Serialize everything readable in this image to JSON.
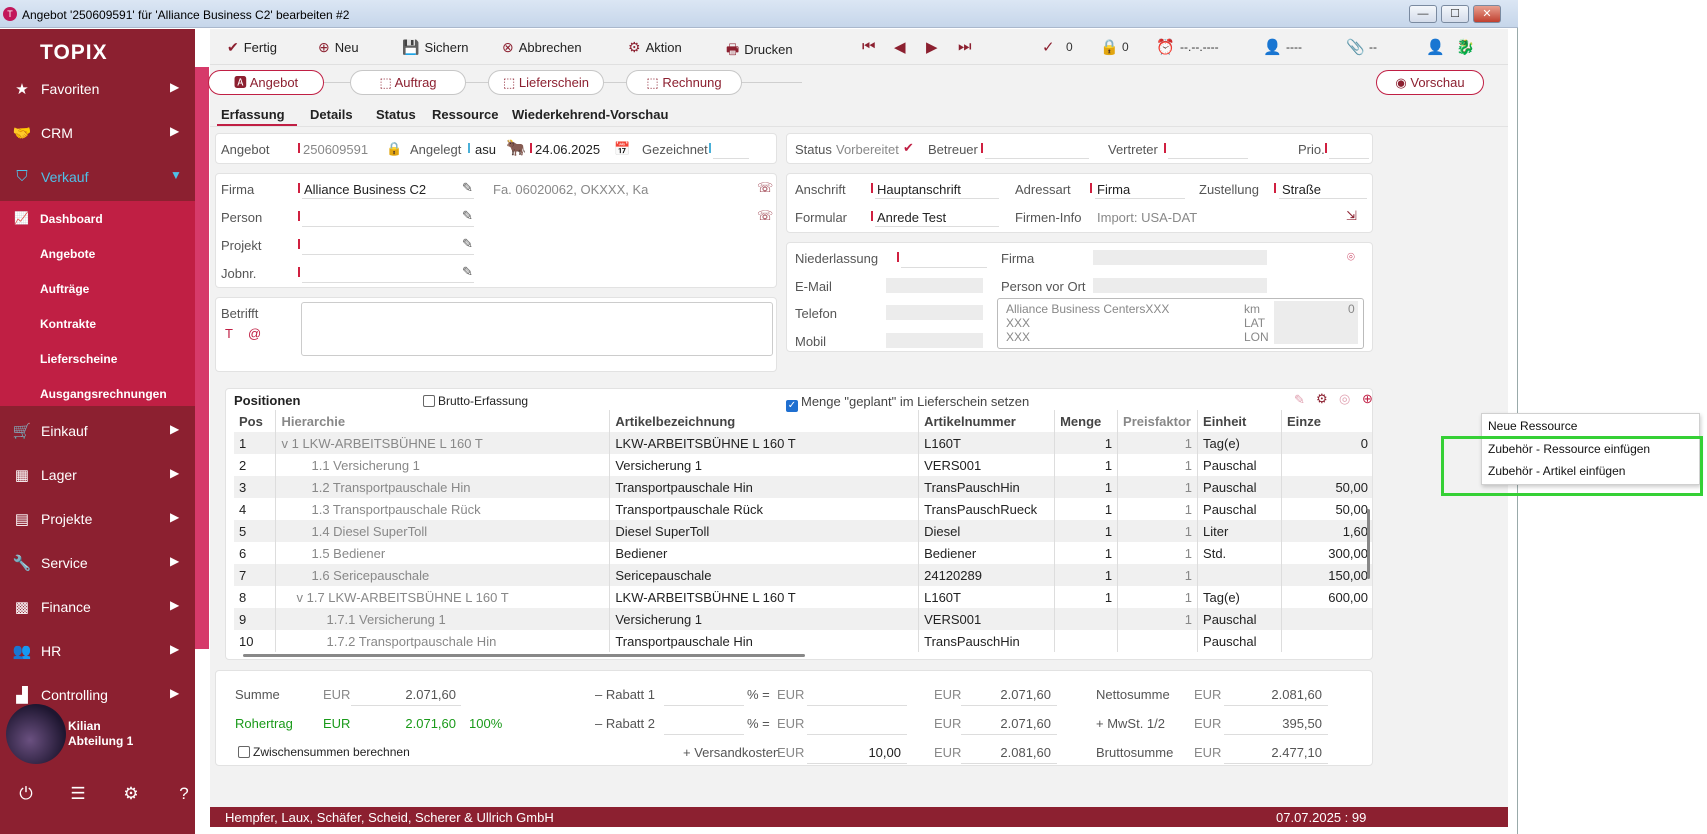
{
  "window": {
    "title": "Angebot '250609591' für 'Alliance Business C2' bearbeiten #2",
    "min": "—",
    "max": "☐",
    "close": "✕"
  },
  "sidebar": {
    "logo": "TOPIX",
    "items": [
      {
        "label": "Favoriten",
        "icon": "star-icon"
      },
      {
        "label": "CRM",
        "icon": "handshake-icon"
      },
      {
        "label": "Verkauf",
        "icon": "tag-icon"
      },
      {
        "label": "Einkauf",
        "icon": "cart-icon"
      },
      {
        "label": "Lager",
        "icon": "warehouse-icon"
      },
      {
        "label": "Projekte",
        "icon": "projects-icon"
      },
      {
        "label": "Service",
        "icon": "wrench-icon"
      },
      {
        "label": "Finance",
        "icon": "finance-icon"
      },
      {
        "label": "HR",
        "icon": "people-icon"
      },
      {
        "label": "Controlling",
        "icon": "chart-icon"
      }
    ],
    "sub": [
      "Dashboard",
      "Angebote",
      "Aufträge",
      "Kontrakte",
      "Lieferscheine",
      "Ausgangsrechnungen"
    ],
    "user": {
      "name": "Kilian",
      "dept": "Abteilung 1"
    }
  },
  "toolbar": {
    "fertig": "Fertig",
    "neu": "Neu",
    "sichern": "Sichern",
    "abbrechen": "Abbrechen",
    "aktion": "Aktion",
    "drucken": "Drucken",
    "check_count": "0",
    "lock_count": "0",
    "date_placeholder": "--.--.----",
    "person_placeholder": "----",
    "link_placeholder": "--"
  },
  "workflow": {
    "angebot": "Angebot",
    "auftrag": "Auftrag",
    "lieferschein": "Lieferschein",
    "rechnung": "Rechnung",
    "vorschau": "Vorschau"
  },
  "tabs": [
    "Erfassung",
    "Details",
    "Status",
    "Ressource",
    "Wiederkehrend-Vorschau"
  ],
  "header": {
    "angebot_label": "Angebot",
    "angebot_value": "250609591",
    "angelegt_label": "Angelegt",
    "angelegt_user": "asu",
    "angelegt_date": "24.06.2025",
    "gezeichnet_label": "Gezeichnet",
    "status_label": "Status",
    "status_value": "Vorbereitet",
    "betreuer_label": "Betreuer",
    "vertreter_label": "Vertreter",
    "prio_label": "Prio."
  },
  "customer": {
    "firma_label": "Firma",
    "firma_value": "Alliance Business C2",
    "firma_info": "Fa. 06020062, OKXXX, Ka",
    "person_label": "Person",
    "projekt_label": "Projekt",
    "jobnr_label": "Jobnr.",
    "anschrift_label": "Anschrift",
    "anschrift_value": "Hauptanschrift",
    "adressart_label": "Adressart",
    "adressart_value": "Firma",
    "zustellung_label": "Zustellung",
    "zustellung_value": "Straße",
    "formular_label": "Formular",
    "formular_value": "Anrede Test",
    "firmeninfo_label": "Firmen-Info",
    "firmeninfo_value": "Import: USA-DAT"
  },
  "contact": {
    "niederlassung_label": "Niederlassung",
    "firma_label": "Firma",
    "email_label": "E-Mail",
    "person_vor_ort_label": "Person vor Ort",
    "telefon_label": "Telefon",
    "mobil_label": "Mobil",
    "address": [
      "Alliance Business CentersXXX",
      "XXX",
      "XXX"
    ],
    "km_label": "km",
    "km_value": "0",
    "lat_label": "LAT",
    "lon_label": "LON"
  },
  "betrifft_label": "Betrifft",
  "positions": {
    "title": "Positionen",
    "brutto_label": "Brutto-Erfassung",
    "menge_label": "Menge \"geplant\" im Lieferschein setzen",
    "columns": [
      "Pos",
      "Hierarchie",
      "Artikelbezeichnung",
      "Artikelnummer",
      "Menge",
      "Preisfaktor",
      "Einheit",
      "Einze"
    ],
    "rows": [
      [
        "1",
        "v  1 LKW-ARBEITSBÜHNE L 160 T",
        "LKW-ARBEITSBÜHNE L 160 T",
        "L160T",
        "1",
        "1",
        "Tag(e)",
        "0"
      ],
      [
        "2",
        "1.1 Versicherung 1",
        "Versicherung 1",
        "VERS001",
        "1",
        "1",
        "Pauschal",
        ""
      ],
      [
        "3",
        "1.2 Transportpauschale Hin",
        "Transportpauschale Hin",
        "TransPauschHin",
        "1",
        "1",
        "Pauschal",
        "50,00"
      ],
      [
        "4",
        "1.3 Transportpauschale Rück",
        "Transportpauschale Rück",
        "TransPauschRueck",
        "1",
        "1",
        "Pauschal",
        "50,00"
      ],
      [
        "5",
        "1.4 Diesel SuperToll",
        "Diesel SuperToll",
        "Diesel",
        "1",
        "1",
        "Liter",
        "1,60"
      ],
      [
        "6",
        "1.5 Bediener",
        "Bediener",
        "Bediener",
        "1",
        "1",
        "Std.",
        "300,00"
      ],
      [
        "7",
        "1.6 Sericepauschale",
        "Sericepauschale",
        "24120289",
        "1",
        "1",
        "",
        "150,00"
      ],
      [
        "8",
        "v  1.7 LKW-ARBEITSBÜHNE L 160 T",
        "LKW-ARBEITSBÜHNE L 160 T",
        "L160T",
        "1",
        "1",
        "Tag(e)",
        "600,00"
      ],
      [
        "9",
        "1.7.1 Versicherung 1",
        "Versicherung 1",
        "VERS001",
        "",
        "1",
        "Pauschal",
        ""
      ],
      [
        "10",
        "1.7.2 Transportpauschale Hin",
        "Transportpauschale Hin",
        "TransPauschHin",
        "",
        "",
        "Pauschal",
        ""
      ]
    ]
  },
  "context_menu": [
    "Neue Ressource",
    "Zubehör - Ressource einfügen",
    "Zubehör - Artikel einfügen"
  ],
  "totals": {
    "summe_label": "Summe",
    "summe_cur": "EUR",
    "summe_val": "2.071,60",
    "rohertrag_label": "Rohertrag",
    "rohertrag_cur": "EUR",
    "rohertrag_val": "2.071,60",
    "rohertrag_pct": "100%",
    "rabatt1_label": "– Rabatt 1",
    "rabatt2_label": "– Rabatt 2",
    "pct_eq": "% =",
    "eur": "EUR",
    "col2_val1": "2.071,60",
    "col2_val2": "2.071,60",
    "col2_val3": "2.081,60",
    "versand_label": "+ Versandkosten",
    "versand_val": "10,00",
    "netto_label": "Nettosumme",
    "netto_val": "2.081,60",
    "mwst_label": "+ MwSt. 1/2",
    "mwst_val": "395,50",
    "brutto_label": "Bruttosumme",
    "brutto_val": "2.477,10",
    "zwischen_label": "Zwischensummen berechnen"
  },
  "footer": {
    "company": "Hempfer, Laux, Schäfer, Scheid, Scherer & Ullrich GmbH",
    "date": "07.07.2025 : 99"
  }
}
